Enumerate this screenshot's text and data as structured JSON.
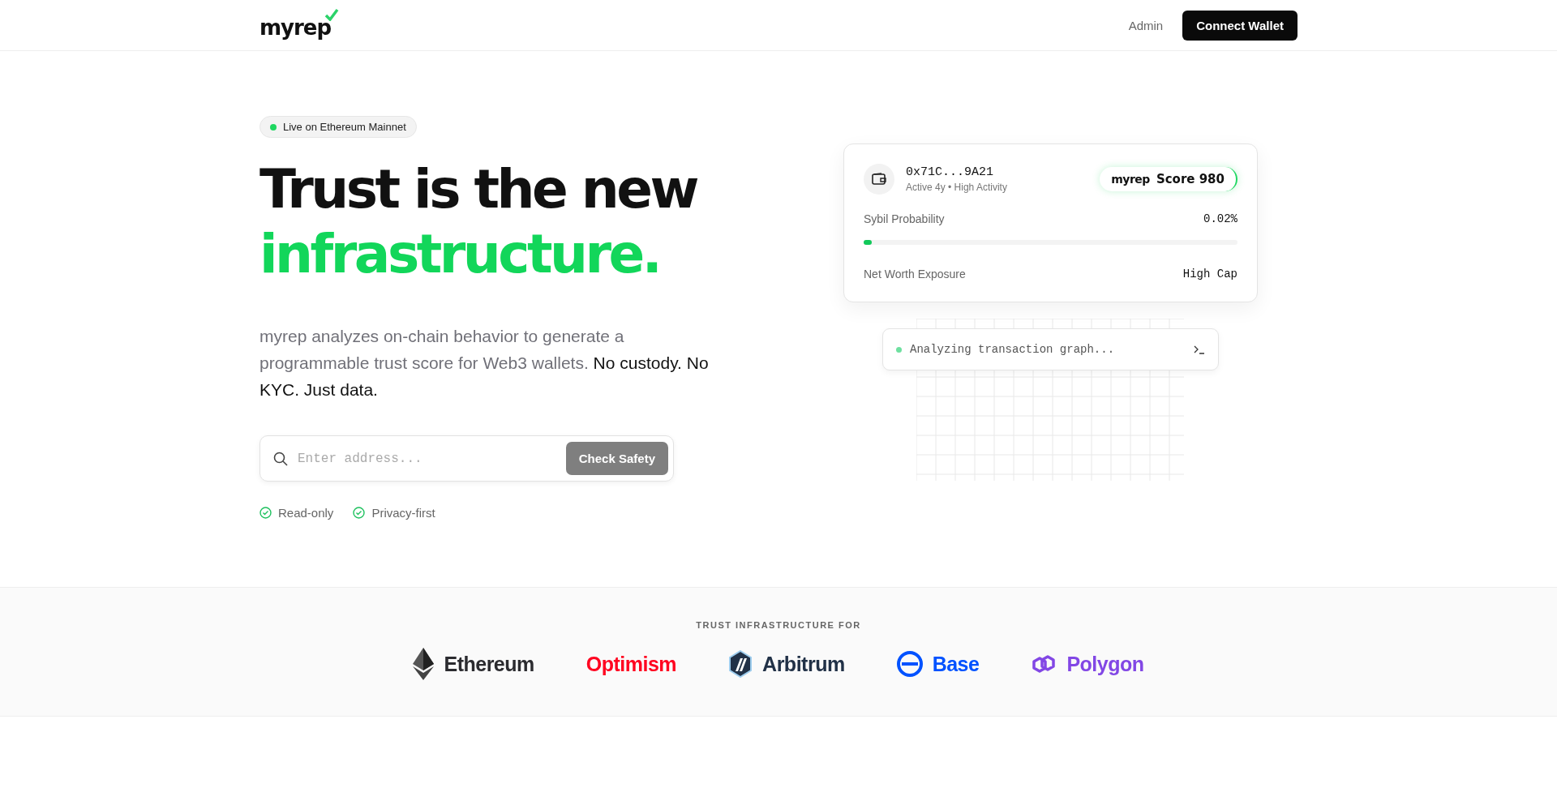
{
  "header": {
    "logo": "myrep",
    "nav": [
      {
        "label": "Admin"
      }
    ],
    "cta": "Connect Wallet"
  },
  "hero": {
    "badge": "Live on Ethereum Mainnet",
    "headline": "Trust is the new",
    "headline_accent": "infrastructure.",
    "description": "myrep analyzes on-chain behavior to generate a programmable trust score for Web3 wallets. **No custody. No KYC. Just data.**",
    "search": {
      "placeholder": "Enter address...",
      "button": "Check Safety"
    },
    "features": [
      "Read-only",
      "Privacy-first"
    ]
  },
  "wallet_card": {
    "address": "0x71C...9A21",
    "meta": "Active 4y • High Activity",
    "score_logo": "myrep",
    "score": "Score 980",
    "metrics": [
      {
        "kind": "bar",
        "label": "Sybil Probability",
        "value": "0.02%",
        "level": 0.02
      },
      {
        "kind": "plain",
        "label": "Net Worth Exposure",
        "value": "High Cap"
      }
    ]
  },
  "terminal": {
    "text": "Analyzing transaction graph..."
  },
  "networks": {
    "label": "TRUST INFRASTRUCTURE FOR",
    "items": [
      {
        "kind": "ethereum",
        "name": "Ethereum",
        "color": "#2b2b2f"
      },
      {
        "kind": "optimism",
        "name": "Optimism",
        "color": "#ff0420"
      },
      {
        "kind": "arbitrum",
        "name": "Arbitrum",
        "color": "#213147"
      },
      {
        "kind": "base",
        "name": "Base",
        "color": "#0052ff"
      },
      {
        "kind": "polygon",
        "name": "Polygon",
        "color": "#8247e5"
      }
    ]
  }
}
